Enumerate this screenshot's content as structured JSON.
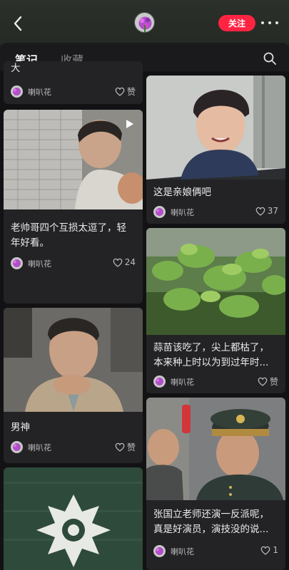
{
  "header": {
    "back_icon": "chevron-left-icon",
    "follow_label": "关注",
    "more_icon": "more-dots-icon"
  },
  "tabs": [
    {
      "label": "笔记",
      "active": true
    },
    {
      "label": "收藏",
      "active": false
    }
  ],
  "search_icon": "search-icon",
  "colors": {
    "accent": "#ff2442",
    "background": "#1a1a1c",
    "card": "#232326"
  },
  "left_column": [
    {
      "title": "大",
      "author": "喇叭花",
      "likes": "赞"
    },
    {
      "title": "老帅哥四个互损太逗了，轻年好看。",
      "author": "喇叭花",
      "likes": "24",
      "video": true
    },
    {
      "title": "男神",
      "author": "喇叭花",
      "likes": "赞"
    },
    {
      "title": "",
      "author": "",
      "likes": ""
    }
  ],
  "right_column": [
    {
      "title": "这是亲娘俩吧",
      "author": "喇叭花",
      "likes": "37"
    },
    {
      "title": "蒜苗该吃了，尖上都枯了，本来种上时以为到过年时...",
      "author": "喇叭花",
      "likes": "赞"
    },
    {
      "title": "张国立老师还演一反派呢，真是好演员，演技没的说...",
      "author": "喇叭花",
      "likes": "1"
    }
  ]
}
